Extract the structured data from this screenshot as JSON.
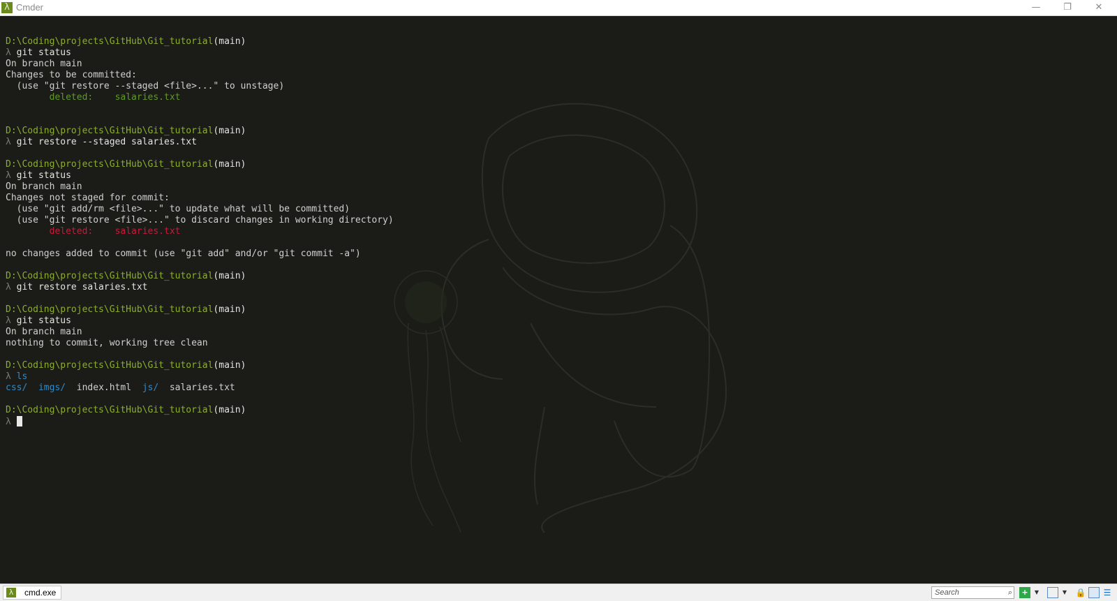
{
  "window": {
    "title": "Cmder",
    "app_icon": "λ",
    "minimize_glyph": "—",
    "maximize_glyph": "❐",
    "close_glyph": "✕"
  },
  "terminal": {
    "path": "D:\\Coding\\projects\\GitHub\\Git_tutorial",
    "branch": "(main)",
    "prompt": "λ",
    "blocks": [
      {
        "command": "git status",
        "output": [
          "On branch main",
          "Changes to be committed:",
          "  (use \"git restore --staged <file>...\" to unstage)"
        ],
        "file_status": {
          "label": "deleted:",
          "file": "salaries.txt",
          "kind": "staged"
        },
        "after_blank": 2
      },
      {
        "command": "git restore --staged salaries.txt",
        "output": [],
        "after_blank": 1
      },
      {
        "command": "git status",
        "output": [
          "On branch main",
          "Changes not staged for commit:",
          "  (use \"git add/rm <file>...\" to update what will be committed)",
          "  (use \"git restore <file>...\" to discard changes in working directory)"
        ],
        "file_status": {
          "label": "deleted:",
          "file": "salaries.txt",
          "kind": "unstaged"
        },
        "trailing": "no changes added to commit (use \"git add\" and/or \"git commit -a\")",
        "after_blank": 1
      },
      {
        "command": "git restore salaries.txt",
        "output": [],
        "after_blank": 1
      },
      {
        "command": "git status",
        "output": [
          "On branch main",
          "nothing to commit, working tree clean"
        ],
        "after_blank": 1
      },
      {
        "command": "ls",
        "ls_entries": [
          {
            "name": "css/",
            "is_dir": true
          },
          {
            "name": "imgs/",
            "is_dir": true
          },
          {
            "name": "index.html",
            "is_dir": false
          },
          {
            "name": "js/",
            "is_dir": true
          },
          {
            "name": "salaries.txt",
            "is_dir": false
          }
        ],
        "after_blank": 1
      }
    ]
  },
  "statusbar": {
    "tab_label": "cmd.exe",
    "tab_icon": "λ",
    "search_placeholder": "Search",
    "search_icon": "⌕",
    "new_console_icon": "+",
    "dropdown_glyph": "▼",
    "lock_glyph": "🔒",
    "menu_glyph": "☰"
  },
  "colors": {
    "path": "#8cae2e",
    "staged": "#5f9a28",
    "unstaged": "#c81a3c",
    "directory": "#2e8acb",
    "background": "#1b1c17"
  },
  "icons": {
    "app": "lambda-icon",
    "search": "search-icon",
    "new_console": "plus-icon",
    "lock": "lock-icon",
    "menu": "hamburger-menu-icon"
  }
}
